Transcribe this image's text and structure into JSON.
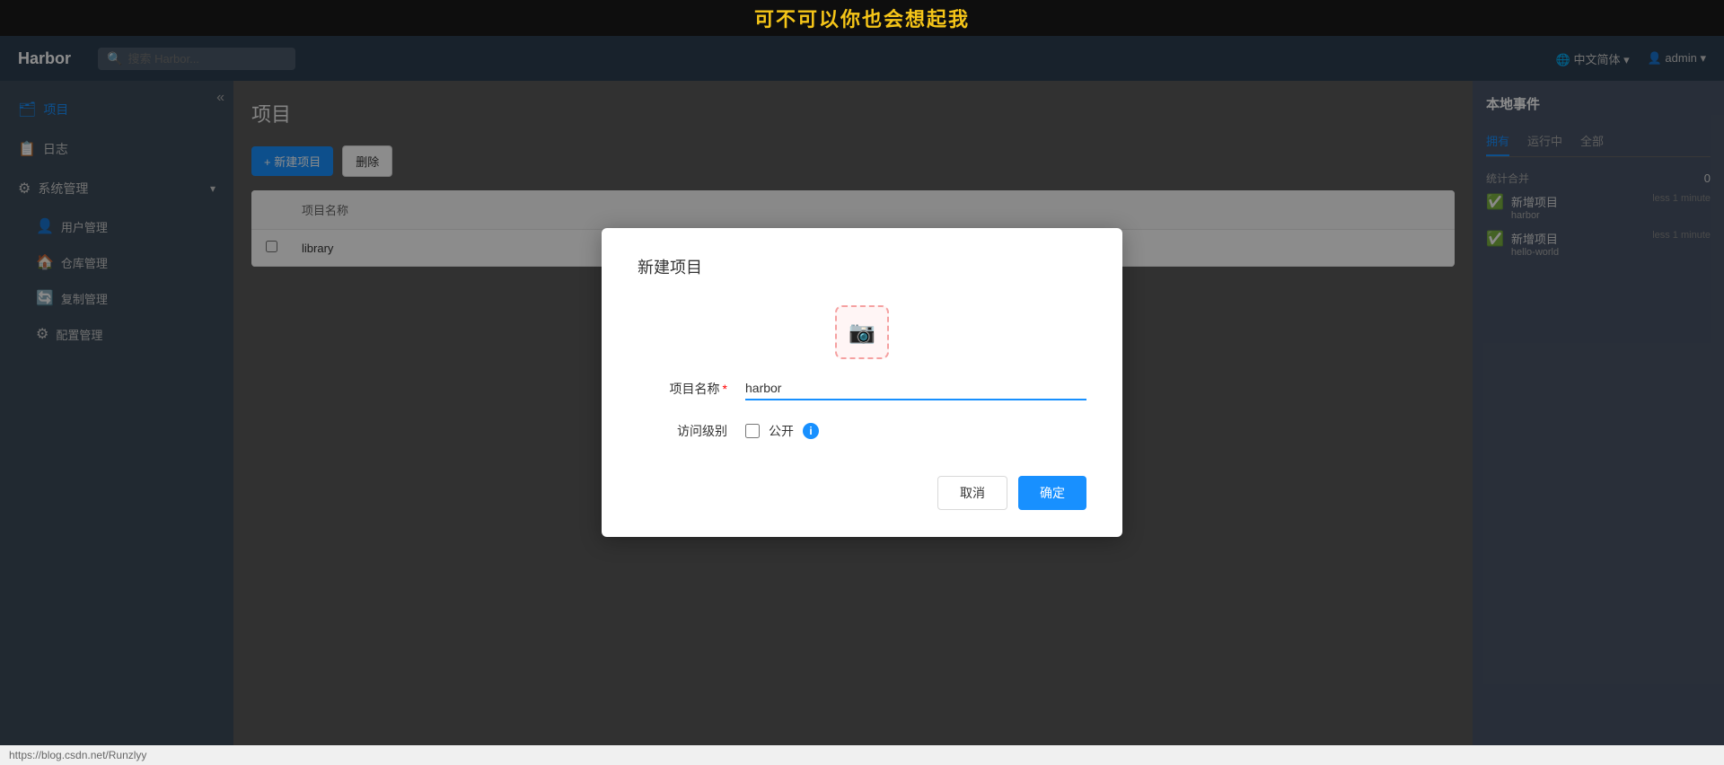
{
  "music_bar": {
    "title": "可不可以你也会想起我"
  },
  "header": {
    "logo": "Harbor",
    "search_placeholder": "搜索 Harbor...",
    "language": "中文简体",
    "language_icon": "🌐",
    "user": "admin",
    "user_icon": "👤"
  },
  "sidebar": {
    "collapse_icon": "«",
    "items": [
      {
        "id": "projects",
        "label": "项目",
        "active": true,
        "icon": "🗂"
      },
      {
        "id": "logs",
        "label": "日志",
        "active": false,
        "icon": "📋"
      },
      {
        "id": "system",
        "label": "系统管理",
        "active": false,
        "icon": "⚙",
        "expandable": true
      },
      {
        "id": "users",
        "label": "用户管理",
        "active": false,
        "icon": "👤",
        "sub": true
      },
      {
        "id": "repos",
        "label": "仓库管理",
        "active": false,
        "icon": "🏠",
        "sub": true
      },
      {
        "id": "replication",
        "label": "复制管理",
        "active": false,
        "icon": "🔄",
        "sub": true
      },
      {
        "id": "config",
        "label": "配置管理",
        "active": false,
        "icon": "⚙",
        "sub": true
      }
    ]
  },
  "content": {
    "page_title": "项目",
    "toolbar": {
      "new_project_label": "+ 新建项目",
      "delete_label": "删除"
    },
    "table": {
      "columns": [
        "",
        "项目名称",
        "",
        "",
        ""
      ],
      "rows": [
        {
          "name": "library",
          "checked": false
        }
      ]
    }
  },
  "right_panel": {
    "title": "本地事件",
    "tabs": [
      {
        "label": "拥有",
        "active": true
      },
      {
        "label": "运行中",
        "active": false
      },
      {
        "label": "全部",
        "active": false
      }
    ],
    "section_label": "统计合并",
    "count": "0",
    "events": [
      {
        "id": 1,
        "name": "新增项目",
        "sub": "harbor",
        "time": "less 1 minute",
        "checked": true
      },
      {
        "id": 2,
        "name": "新增项目",
        "sub": "hello-world",
        "time": "less 1 minute",
        "checked": true
      }
    ]
  },
  "modal": {
    "title": "新建项目",
    "upload_icon": "📷",
    "fields": {
      "project_name": {
        "label": "项目名称",
        "required": true,
        "value": "harbor",
        "placeholder": ""
      },
      "access_level": {
        "label": "访问级别",
        "public_label": "公开",
        "checked": false
      }
    },
    "buttons": {
      "cancel": "取消",
      "confirm": "确定"
    }
  },
  "url_bar": {
    "url": "https://blog.csdn.net/Runzlyy"
  }
}
